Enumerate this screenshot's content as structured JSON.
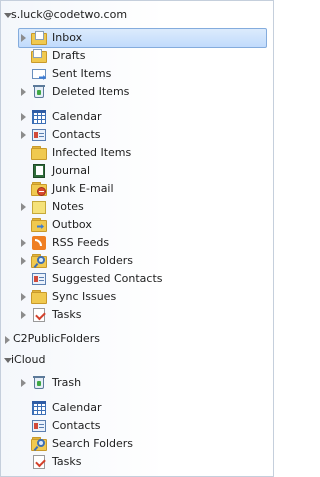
{
  "pane": {
    "accounts": [
      {
        "name": "s.luck@codetwo.com",
        "expanded": true,
        "folders": [
          {
            "label": "Inbox",
            "icon": "inbox-folder-icon",
            "expander": "collapsed",
            "selected": true
          },
          {
            "label": "Drafts",
            "icon": "drafts-icon",
            "expander": "none"
          },
          {
            "label": "Sent Items",
            "icon": "sent-items-icon",
            "expander": "none"
          },
          {
            "label": "Deleted Items",
            "icon": "deleted-items-icon",
            "expander": "collapsed"
          },
          {
            "label": "Calendar",
            "icon": "calendar-icon",
            "expander": "collapsed"
          },
          {
            "label": "Contacts",
            "icon": "contacts-icon",
            "expander": "collapsed"
          },
          {
            "label": "Infected Items",
            "icon": "folder-icon",
            "expander": "none"
          },
          {
            "label": "Journal",
            "icon": "journal-icon",
            "expander": "none"
          },
          {
            "label": "Junk E-mail",
            "icon": "junk-email-icon",
            "expander": "none"
          },
          {
            "label": "Notes",
            "icon": "notes-icon",
            "expander": "collapsed"
          },
          {
            "label": "Outbox",
            "icon": "outbox-icon",
            "expander": "none"
          },
          {
            "label": "RSS Feeds",
            "icon": "rss-icon",
            "expander": "collapsed"
          },
          {
            "label": "Search Folders",
            "icon": "search-folder-icon",
            "expander": "collapsed"
          },
          {
            "label": "Suggested Contacts",
            "icon": "contacts-icon",
            "expander": "none"
          },
          {
            "label": "Sync Issues",
            "icon": "folder-icon",
            "expander": "collapsed"
          },
          {
            "label": "Tasks",
            "icon": "tasks-icon",
            "expander": "collapsed"
          }
        ]
      },
      {
        "name": "C2PublicFolders",
        "expanded": false,
        "folders": []
      },
      {
        "name": "iCloud",
        "expanded": true,
        "folders": [
          {
            "label": "Trash",
            "icon": "trash-icon",
            "expander": "collapsed"
          },
          {
            "label": "Calendar",
            "icon": "calendar-icon",
            "expander": "none"
          },
          {
            "label": "Contacts",
            "icon": "contacts-icon",
            "expander": "none"
          },
          {
            "label": "Search Folders",
            "icon": "search-folder-icon",
            "expander": "none"
          },
          {
            "label": "Tasks",
            "icon": "tasks-icon",
            "expander": "none"
          }
        ]
      }
    ]
  },
  "colors": {
    "selection": "#c1dbfc",
    "selection_border": "#84acdd",
    "pane_border": "#c5cfdc"
  }
}
